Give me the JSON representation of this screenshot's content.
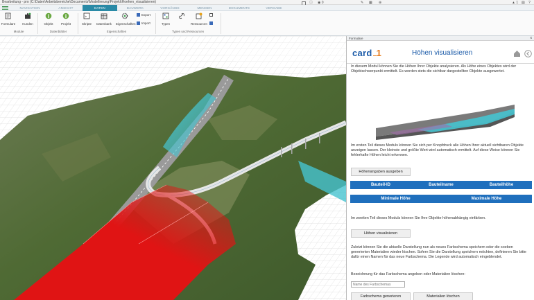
{
  "window": {
    "title": "Bearbeitung - pro (C:\\Daten\\Arbeitsbereiche\\Documents\\Modellierung\\Projekt\\Hoehen_visualisieren)"
  },
  "tabs": [
    {
      "label": "NAVIGATION",
      "active": false
    },
    {
      "label": "ANSICHT",
      "active": false
    },
    {
      "label": "DATEN",
      "active": true
    },
    {
      "label": "BAUWERK",
      "active": false
    },
    {
      "label": "VORGÄNGE",
      "active": false
    },
    {
      "label": "MENGEN",
      "active": false
    },
    {
      "label": "DOKUMENTE",
      "active": false
    },
    {
      "label": "VERGABE",
      "active": false
    }
  ],
  "titlebar_right": {
    "count": "0",
    "notifications": "1"
  },
  "ribbon": {
    "formulare": "Formulare",
    "kunden": "Kunden",
    "objekt": "Objekt",
    "projekt": "Projekt",
    "skripte": "Skripte",
    "datenbank": "Datenbank",
    "eigenschaften": "Eigenschaften",
    "export": "Export",
    "import": "Import",
    "typen": "Typen",
    "ressourcen": "Ressourcen",
    "groups": {
      "module": "Module",
      "datenblaetter": "Datenblätter",
      "eigenschaften": "Eigenschaften",
      "typen_ressourcen": "Typen und Ressourcen"
    }
  },
  "panel": {
    "header": "Formulare",
    "close": "x",
    "brand": "card",
    "brand_suffix": "1",
    "title": "Höhen visualisieren",
    "intro": "In diesem Modul können Sie die Höhen Ihrer Objekte analysieren. Als Höhe eines Objektes wird der Objektschwerpunkt ermittelt. Es werden stets die sichtbar dargestellten Objekte ausgewertet.",
    "part1": "Im ersten Teil dieses Moduls können Sie sich per Knopfdruck alle Höhen Ihrer aktuell sichtbaren Objekte anzeigen lassen. Der kleinste und größte Wert wird automatisch ermittelt. Auf diese Weise können Sie fehlerhafte Höhen leicht erkennen.",
    "btn_hoehenangaben": "Höhenangaben ausgeben",
    "table_cols": [
      "Bauteil-ID",
      "Bauteilname",
      "Bauteilhöhe"
    ],
    "minmax": [
      "Minimale Höhe",
      "Maximale Höhe"
    ],
    "part2": "Im zweiten Teil dieses Moduls können Sie Ihre Objekte höhenabhängig einfärben.",
    "btn_visualisieren": "Höhen visualisieren",
    "part3": "Zuletzt können Sie die aktuelle Darstellung nun als neues Farbschema speichern oder die soeben generierten Materialien wieder löschen. Sofern Sie die Darstellung speichern möchten, definieren Sie bitte dafür einen Namen für das neue Farbschema. Die Legende wird automatisch eingeblendet.",
    "label_bezeichnung": "Bezeichnung für das Farbschema angeben oder Materialien löschen:",
    "input_placeholder": "Name des Farbschemas",
    "btn_generieren": "Farbschema generieren",
    "btn_loeschen": "Materialien löschen"
  },
  "colors": {
    "accent": "#2a8aa6",
    "brand_blue": "#1a5aa8",
    "bar_blue": "#1f6fbd",
    "road_red": "#e01414",
    "road_cyan": "#46c3cf",
    "terrain_green": "#4f6a34"
  }
}
